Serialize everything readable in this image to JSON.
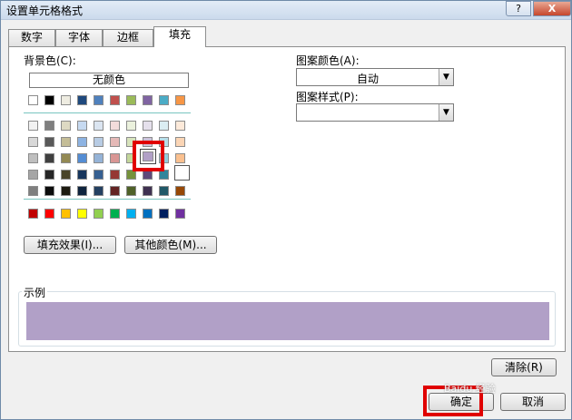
{
  "window": {
    "title": "设置单元格格式",
    "help_button": "?",
    "close_button": "X"
  },
  "tabs": [
    "数字",
    "字体",
    "边框",
    "填充"
  ],
  "active_tab": "填充",
  "fill": {
    "bg_color_label": "背景色(C):",
    "no_color_label": "无颜色",
    "fill_effects_button": "填充效果(I)...",
    "more_colors_button": "其他颜色(M)...",
    "selected_color": "#B1A0C7",
    "palette": {
      "theme_row": [
        "#FFFFFF",
        "#000000",
        "#EEECE1",
        "#1F497D",
        "#4F81BD",
        "#C0504D",
        "#9BBB59",
        "#8064A2",
        "#4BACC6",
        "#F79646"
      ],
      "tint_rows": [
        [
          "#F2F2F2",
          "#7F7F7F",
          "#DDD9C3",
          "#C6D9F0",
          "#DBE5F1",
          "#F2DCDB",
          "#EBF1DD",
          "#E5E0EC",
          "#DBEEF3",
          "#FDEADA"
        ],
        [
          "#D8D8D8",
          "#595959",
          "#C4BD97",
          "#8DB3E2",
          "#B8CCE4",
          "#E5B9B7",
          "#D7E3BC",
          "#CCC1D9",
          "#B7DDE8",
          "#FBD5B5"
        ],
        [
          "#BFBFBF",
          "#3F3F3F",
          "#938953",
          "#548DD4",
          "#95B3D7",
          "#D99694",
          "#C3D69B",
          "#B1A0C7",
          "#92CDDC",
          "#FAC08F"
        ],
        [
          "#A5A5A5",
          "#262626",
          "#494429",
          "#17365D",
          "#366092",
          "#953734",
          "#76923C",
          "#5F497A",
          "#31859B",
          "#E36C09"
        ],
        [
          "#7F7F7F",
          "#0C0C0C",
          "#1D1B10",
          "#0F243E",
          "#244061",
          "#632423",
          "#4F6128",
          "#3F3151",
          "#205867",
          "#974806"
        ]
      ],
      "standard_row": [
        "#C00000",
        "#FF0000",
        "#FFC000",
        "#FFFF00",
        "#92D050",
        "#00B050",
        "#00B0F0",
        "#0070C0",
        "#002060",
        "#7030A0"
      ]
    }
  },
  "pattern": {
    "color_label": "图案颜色(A):",
    "color_value": "自动",
    "style_label": "图案样式(P):",
    "style_value": ""
  },
  "sample": {
    "label": "示例"
  },
  "buttons": {
    "clear": "清除(R)",
    "ok": "确定",
    "cancel": "取消"
  },
  "watermark": "Baidu 经验",
  "icons": {
    "dropdown": "chevron-down-icon"
  }
}
